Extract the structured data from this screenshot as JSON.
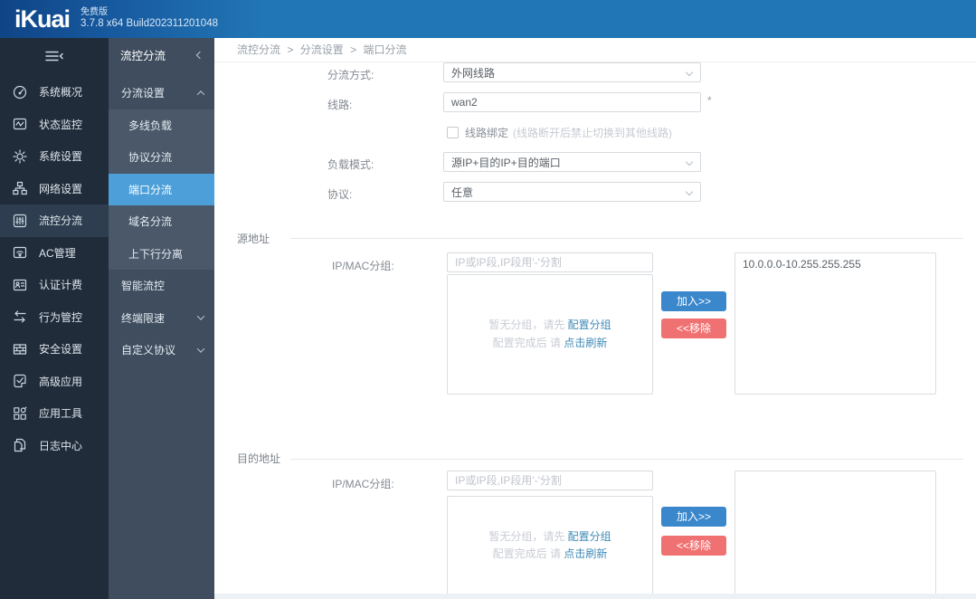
{
  "app": {
    "logo": "iKuai",
    "edition": "免费版",
    "build": "3.7.8 x64 Build202311201048"
  },
  "colors": {
    "topbar": "#2176b5",
    "submenu_selected": "#4c9fd8",
    "add_button": "#3a87cb",
    "remove_button": "#f07172",
    "link": "#3e8ab6"
  },
  "sidebar": {
    "items": [
      {
        "label": "系统概况",
        "icon": "gauge-icon",
        "active": false
      },
      {
        "label": "状态监控",
        "icon": "monitor-icon",
        "active": false
      },
      {
        "label": "系统设置",
        "icon": "gear-icon",
        "active": false
      },
      {
        "label": "网络设置",
        "icon": "network-icon",
        "active": false
      },
      {
        "label": "流控分流",
        "icon": "sliders-icon",
        "active": true
      },
      {
        "label": "AC管理",
        "icon": "wifi-icon",
        "active": false
      },
      {
        "label": "认证计费",
        "icon": "id-card-icon",
        "active": false
      },
      {
        "label": "行为管控",
        "icon": "swap-arrows-icon",
        "active": false
      },
      {
        "label": "安全设置",
        "icon": "firewall-icon",
        "active": false
      },
      {
        "label": "高级应用",
        "icon": "check-note-icon",
        "active": false
      },
      {
        "label": "应用工具",
        "icon": "app-grid-icon",
        "active": false
      },
      {
        "label": "日志中心",
        "icon": "log-pages-icon",
        "active": false
      }
    ]
  },
  "submenu": {
    "header": "流控分流",
    "items": [
      {
        "label": "分流设置",
        "type": "parent-expanded"
      },
      {
        "label": "多线负载",
        "type": "child"
      },
      {
        "label": "协议分流",
        "type": "child"
      },
      {
        "label": "端口分流",
        "type": "child-selected"
      },
      {
        "label": "域名分流",
        "type": "child"
      },
      {
        "label": "上下行分离",
        "type": "child"
      },
      {
        "label": "智能流控",
        "type": "plain"
      },
      {
        "label": "终端限速",
        "type": "collapsed"
      },
      {
        "label": "自定义协议",
        "type": "collapsed"
      }
    ]
  },
  "breadcrumb": {
    "separator": ">",
    "items": [
      "流控分流",
      "分流设置",
      "端口分流"
    ]
  },
  "form": {
    "split_mode": {
      "label": "分流方式:",
      "value": "外网线路"
    },
    "line": {
      "label": "线路:",
      "value": "wan2",
      "required_mark": "*"
    },
    "line_bind": {
      "label": "线路绑定",
      "hint": "(线路断开后禁止切换到其他线路)",
      "checked": false
    },
    "load_mode": {
      "label": "负载模式:",
      "value": "源IP+目的IP+目的端口"
    },
    "protocol": {
      "label": "协议:",
      "value": "任意"
    }
  },
  "source_section": {
    "title": "源地址",
    "group_label": "IP/MAC分组:",
    "input_placeholder": "IP或IP段,IP段用'-'分割",
    "empty_line1_text": "暂无分组，请先",
    "empty_line1_link": "配置分组",
    "empty_line2_text": "配置完成后 请",
    "empty_line2_link": "点击刷新",
    "add_button": "加入>>",
    "remove_button": "<<移除",
    "selected_items": [
      "10.0.0.0-10.255.255.255"
    ]
  },
  "dest_section": {
    "title": "目的地址",
    "group_label": "IP/MAC分组:",
    "input_placeholder": "IP或IP段,IP段用'-'分割",
    "empty_line1_text": "暂无分组，请先",
    "empty_line1_link": "配置分组",
    "empty_line2_text": "配置完成后 请",
    "empty_line2_link": "点击刷新",
    "add_button": "加入>>",
    "remove_button": "<<移除",
    "selected_items": []
  }
}
